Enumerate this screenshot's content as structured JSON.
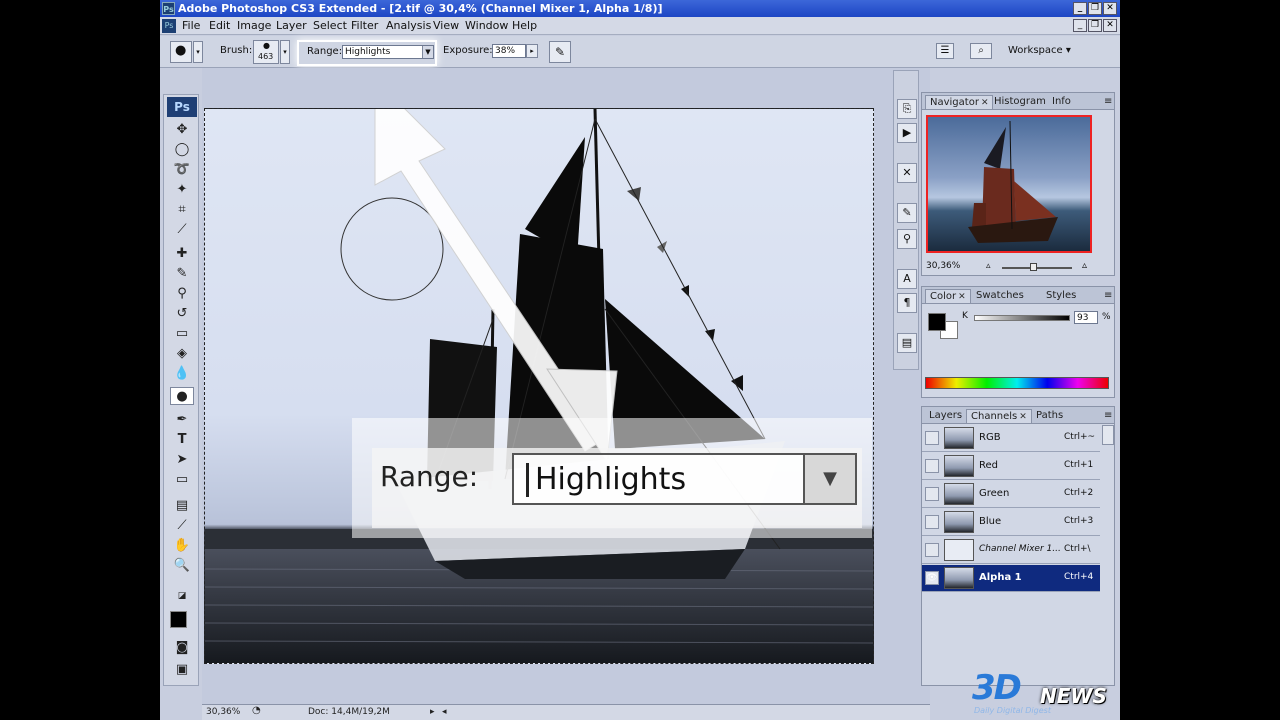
{
  "window": {
    "title": "Adobe Photoshop CS3 Extended - [2.tif @ 30,4% (Channel Mixer 1, Alpha 1/8)]",
    "minimize": "_",
    "restore": "❐",
    "close": "✕"
  },
  "menu": [
    "File",
    "Edit",
    "Image",
    "Layer",
    "Select",
    "Filter",
    "Analysis",
    "View",
    "Window",
    "Help"
  ],
  "options": {
    "brush_label": "Brush:",
    "brush_size": "463",
    "range_label": "Range:",
    "range_value": "Highlights",
    "exposure_label": "Exposure:",
    "exposure_value": "38%",
    "workspace_label": "Workspace ▾"
  },
  "tools_panel": {
    "logo": "Ps"
  },
  "callout": {
    "range_label": "Range:",
    "range_value": "Highlights",
    "dropdown": "▼"
  },
  "status": {
    "zoom": "30,36%",
    "doc": "Doc: 14,4M/19,2M"
  },
  "navigator": {
    "tabs": [
      "Navigator",
      "Histogram",
      "Info"
    ],
    "zoom": "30,36%"
  },
  "color": {
    "tabs": [
      "Color",
      "Swatches",
      "Styles"
    ],
    "channel": "K",
    "value": "93",
    "unit": "%"
  },
  "channels": {
    "tabs": [
      "Layers",
      "Channels",
      "Paths"
    ],
    "rows": [
      {
        "name": "RGB",
        "key": "Ctrl+~",
        "visible": ""
      },
      {
        "name": "Red",
        "key": "Ctrl+1",
        "visible": ""
      },
      {
        "name": "Green",
        "key": "Ctrl+2",
        "visible": ""
      },
      {
        "name": "Blue",
        "key": "Ctrl+3",
        "visible": ""
      },
      {
        "name": "Channel Mixer 1...",
        "key": "Ctrl+\\",
        "visible": ""
      },
      {
        "name": "Alpha 1",
        "key": "Ctrl+4",
        "visible": "👁"
      }
    ]
  },
  "watermark": {
    "brand": "3D",
    "brand2": "NEWS",
    "tagline": "Daily Digital Digest"
  },
  "colors": {
    "title_bar": "#1d46c4",
    "selected_row": "#0f2a7f",
    "arrow": "#ffffff"
  }
}
